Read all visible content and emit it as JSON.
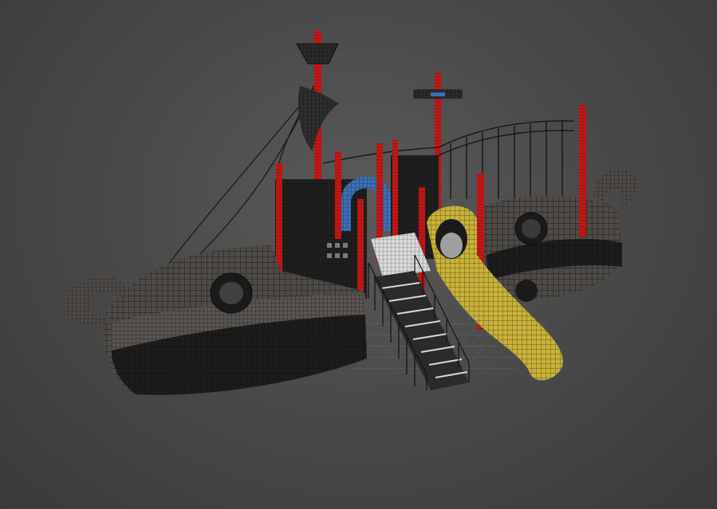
{
  "viewport": {
    "background_top": "#5a5a5a",
    "background_bottom": "#3a3a3a",
    "render_mode": "wireframe-over-shaded"
  },
  "model": {
    "object": "pirate-ship-playground",
    "colors": {
      "hull": "#4e4a46",
      "hull_dark": "#1c1c1c",
      "wire": "#0c0c0c",
      "posts": "#c41616",
      "slide": "#c9b23a",
      "arch": "#3c6fb5",
      "platform": "#d8d8d8",
      "railing": "#111111"
    }
  }
}
